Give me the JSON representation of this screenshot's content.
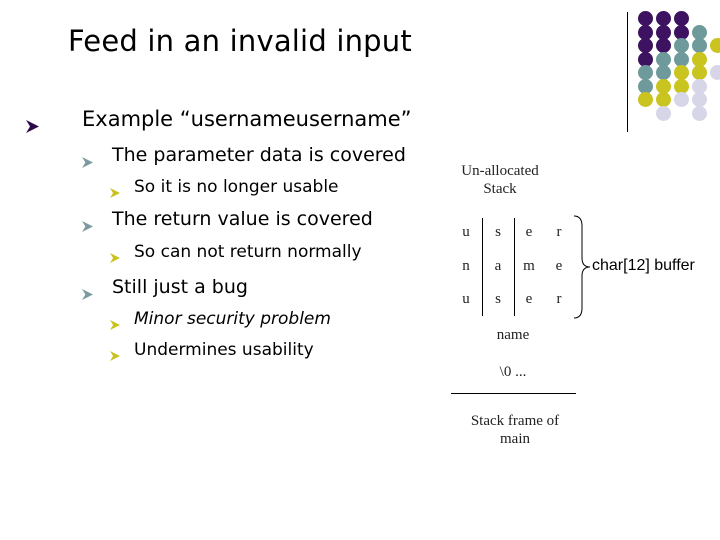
{
  "slide": {
    "title": "Feed in an invalid input",
    "bullets": [
      {
        "level": 1,
        "text": "Example “usernameusername”"
      },
      {
        "level": 2,
        "text": "The parameter data is covered"
      },
      {
        "level": 3,
        "text": "So it is no longer usable"
      },
      {
        "level": 2,
        "text": "The return value is covered"
      },
      {
        "level": 3,
        "text": "So can not return normally"
      },
      {
        "level": 2,
        "text": "Still just a bug"
      },
      {
        "level": 3,
        "text": "Minor security problem"
      },
      {
        "level": 3,
        "text": "Undermines usability"
      }
    ],
    "bullet_colors": {
      "level1": "#2e0a4a",
      "level2": "#7a9aa0",
      "level3": "#c8c21a"
    }
  },
  "diagram": {
    "top_label_line1": "Un-allocated",
    "top_label_line2": "Stack",
    "rows": [
      [
        "u",
        "s",
        "e",
        "r"
      ],
      [
        "n",
        "a",
        "m",
        "e"
      ],
      [
        "u",
        "s",
        "e",
        "r"
      ]
    ],
    "buffer_label": "char[12] buffer",
    "var_name": "name",
    "terminator": "\\0 ...",
    "bottom_label_line1": "Stack frame of",
    "bottom_label_line2": "main"
  },
  "decoration": {
    "dot_colors": {
      "purple": "#3d1260",
      "teal": "#6e9a9c",
      "yellow": "#c9c420",
      "lavender": "#d6d6e8"
    }
  }
}
